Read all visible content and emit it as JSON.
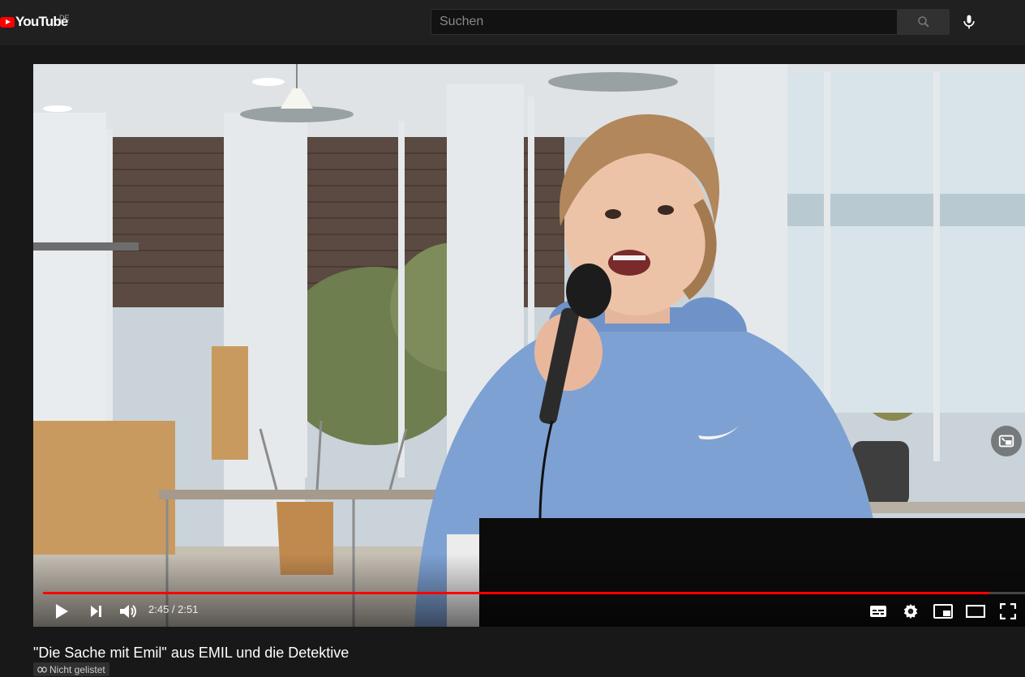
{
  "header": {
    "logo_text": "YouTube",
    "country_code": "DE",
    "search_placeholder": "Suchen"
  },
  "player": {
    "time_current": "2:45",
    "time_separator": " / ",
    "time_total": "2:51",
    "progress": 0.964,
    "progress_color": "#ff0000"
  },
  "video": {
    "title": "\"Die Sache mit Emil\" aus EMIL und die Detektive",
    "visibility": "Nicht gelistet"
  },
  "icons": [
    "youtube-logo",
    "search-icon",
    "microphone-icon",
    "play-icon",
    "next-icon",
    "volume-icon",
    "subtitles-icon",
    "settings-icon",
    "miniplayer-icon",
    "theater-icon",
    "fullscreen-icon",
    "link-icon",
    "fullscreen-overlay-icon"
  ]
}
